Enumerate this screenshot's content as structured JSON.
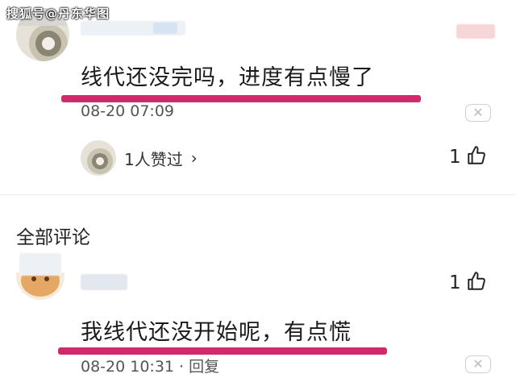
{
  "watermark": "搜狐号@丹东华图",
  "comments": [
    {
      "text": "线代还没完吗，进度有点慢了",
      "time": "08-20 07:09",
      "reply": "",
      "like_count": "1",
      "likers_label": "1人赞过"
    },
    {
      "text": "我线代还没开始呢，有点慌",
      "time": "08-20 10:31 · 回复",
      "like_count": "1"
    }
  ],
  "section_title": "全部评论",
  "icons": {
    "close": "close-icon",
    "like": "thumbs-up-icon",
    "chevron": "chevron-right-icon"
  },
  "colors": {
    "underline": "#d12a6a",
    "text": "#1a1a1a"
  }
}
